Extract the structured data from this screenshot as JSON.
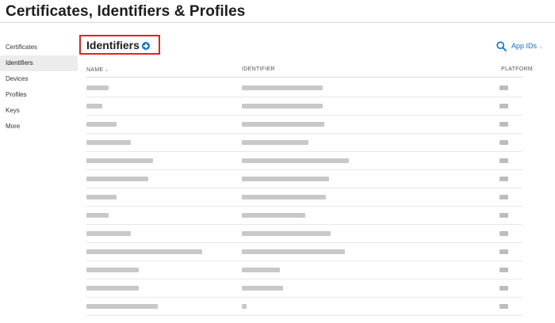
{
  "page": {
    "title": "Certificates, Identifiers & Profiles"
  },
  "sidebar": {
    "items": [
      {
        "label": "Certificates",
        "active": false
      },
      {
        "label": "Identifiers",
        "active": true
      },
      {
        "label": "Devices",
        "active": false
      },
      {
        "label": "Profiles",
        "active": false
      },
      {
        "label": "Keys",
        "active": false
      },
      {
        "label": "More",
        "active": false
      }
    ]
  },
  "section": {
    "title": "Identifiers",
    "add_icon": "plus-circle-icon",
    "highlight_color": "#e0241b"
  },
  "toolbar": {
    "search_icon": "search-icon",
    "filter_label": "App IDs",
    "filter_chevron": "⌄"
  },
  "table": {
    "columns": [
      {
        "label": "NAME",
        "sort_indicator": "⌄"
      },
      {
        "label": "IDENTIFIER"
      },
      {
        "label": "PLATFORM"
      }
    ],
    "row_count": 13
  },
  "colors": {
    "accent": "#0a6ed1",
    "text": "#1d1d1f",
    "redaction": "#c8c8c8"
  }
}
